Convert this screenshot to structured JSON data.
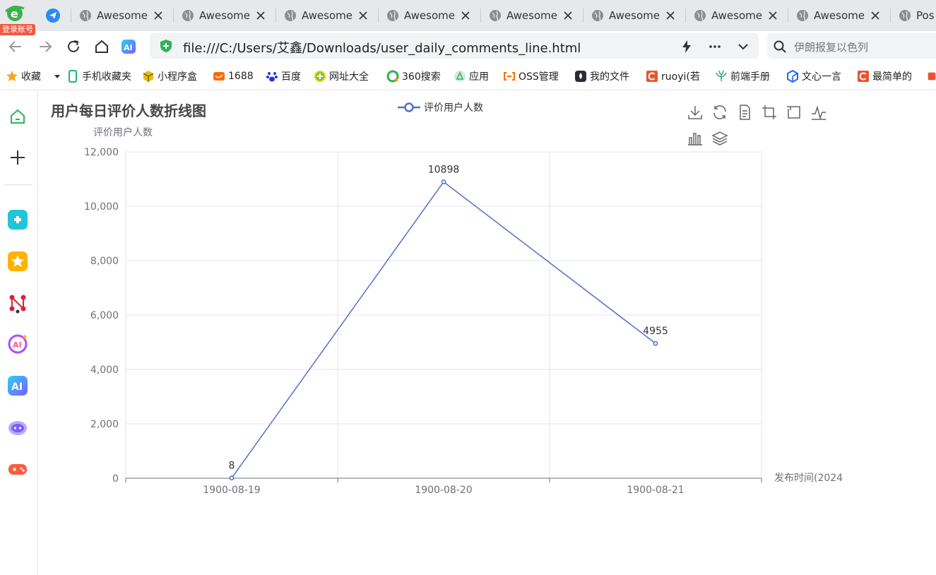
{
  "browser": {
    "login_badge": "登录账号",
    "tabs": [
      {
        "title": "Awesome"
      },
      {
        "title": "Awesome"
      },
      {
        "title": "Awesome"
      },
      {
        "title": "Awesome"
      },
      {
        "title": "Awesome"
      },
      {
        "title": "Awesome"
      },
      {
        "title": "Awesome"
      },
      {
        "title": "Awesome"
      },
      {
        "title": "Pos"
      }
    ],
    "url": "file:///C:/Users/艾鑫/Downloads/user_daily_comments_line.html",
    "search_text": "伊朗报复以色列"
  },
  "bookmarks": [
    {
      "label": "收藏",
      "icon": "star-icon",
      "color": "#f5a623"
    },
    {
      "label": "手机收藏夹",
      "icon": "phone-icon",
      "color": "#22b573"
    },
    {
      "label": "小程序盒",
      "icon": "box-icon",
      "color": "#f7b500"
    },
    {
      "label": "1688",
      "icon": "1688-icon",
      "color": "#ff6a00"
    },
    {
      "label": "百度",
      "icon": "baidu-paw-icon",
      "color": "#2932e1"
    },
    {
      "label": "网址大全",
      "icon": "plus-circle-icon",
      "color": "#7cc242"
    },
    {
      "label": "360搜索",
      "icon": "360-icon",
      "color": "#2ab24a"
    },
    {
      "label": "应用",
      "icon": "app-icon",
      "color": "#55b36f"
    },
    {
      "label": "OSS管理",
      "icon": "oss-icon",
      "color": "#ff6a00"
    },
    {
      "label": "我的文件",
      "icon": "drop-icon",
      "color": "#2b2b3b"
    },
    {
      "label": "ruoyi(若",
      "icon": "c-icon",
      "color": "#e8542f"
    },
    {
      "label": "前端手册",
      "icon": "plant-icon",
      "color": "#36a58a"
    },
    {
      "label": "文心一言",
      "icon": "cube-icon",
      "color": "#2468f2"
    },
    {
      "label": "最简单的",
      "icon": "c-icon",
      "color": "#e8542f"
    }
  ],
  "chart_data": {
    "type": "line",
    "title": "用户每日评价人数折线图",
    "ylabel": "评价用户人数",
    "xlabel": "发布时间(2024",
    "categories": [
      "1900-08-19",
      "1900-08-20",
      "1900-08-21"
    ],
    "series": [
      {
        "name": "评价用户人数",
        "values": [
          8,
          10898,
          4955
        ],
        "color": "#5470c6"
      }
    ],
    "ylim": [
      0,
      12000
    ],
    "yticks": [
      "0",
      "2,000",
      "4,000",
      "6,000",
      "8,000",
      "10,000",
      "12,000"
    ],
    "data_labels": [
      "8",
      "10898",
      "4955"
    ],
    "grid": true,
    "legend_position": "top-center"
  }
}
